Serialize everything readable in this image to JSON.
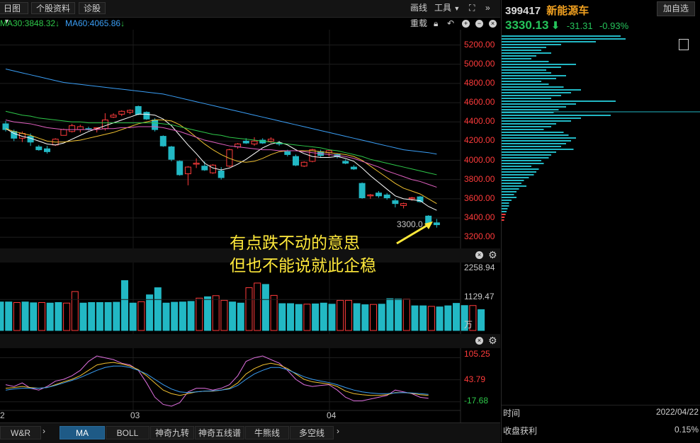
{
  "toolbar": {
    "period_label": "日图",
    "profile_label": "个股资料",
    "diagnose_label": "诊股",
    "draw_label": "画线",
    "tools_label": "工具",
    "reload_label": "重载"
  },
  "ma_legend": {
    "ma30": "MA30:3848.32",
    "ma60": "MA60:4065.86",
    "ma30_color": "#2ec84a",
    "ma60_color": "#3a9ef5"
  },
  "price_axis": {
    "labels": [
      "5200.00",
      "5000.00",
      "4800.00",
      "4600.00",
      "4400.00",
      "4200.00",
      "4000.00",
      "3800.00",
      "3600.00",
      "3400.00",
      "3200.00"
    ],
    "low_marker": "3300.0"
  },
  "volume_axis": {
    "labels": [
      "2258.94",
      "1129.47",
      "万"
    ]
  },
  "macd_axis": {
    "labels": [
      "105.25",
      "43.79",
      "-17.68"
    ]
  },
  "date_axis": {
    "labels": [
      "2",
      "03",
      "04"
    ]
  },
  "annotation": {
    "line1": "有点跌不动的意思",
    "line2": "但也不能说就此企稳",
    "color": "#ffe93b"
  },
  "tabs": {
    "wr": "W&R",
    "items": [
      "MA",
      "BOLL",
      "神奇九转",
      "神奇五线谱",
      "牛熊线",
      "多空线"
    ],
    "active": "MA"
  },
  "right_panel": {
    "code": "399417",
    "name": "新能源车",
    "add_button": "加自选",
    "price": "3330.13",
    "change": "-31.31",
    "change_pct": "-0.93%",
    "down_color": "#25c45b",
    "time_label": "时间",
    "time_value": "2022/04/22",
    "profit_label": "收盘获利",
    "profit_value": "0.15%"
  },
  "chart_data": {
    "type": "candlestick",
    "price_ylim": [
      3150,
      5300
    ],
    "candles": [
      [
        4380,
        4410,
        4300,
        4320
      ],
      [
        4300,
        4320,
        4200,
        4230
      ],
      [
        4230,
        4300,
        4190,
        4280
      ],
      [
        4250,
        4280,
        4150,
        4190
      ],
      [
        4140,
        4160,
        4100,
        4110
      ],
      [
        4120,
        4150,
        4070,
        4090
      ],
      [
        4160,
        4230,
        4150,
        4220
      ],
      [
        4260,
        4330,
        4260,
        4320
      ],
      [
        4300,
        4380,
        4290,
        4360
      ],
      [
        4320,
        4370,
        4290,
        4350
      ],
      [
        4330,
        4350,
        4310,
        4320
      ],
      [
        4330,
        4340,
        4290,
        4340
      ],
      [
        4330,
        4490,
        4310,
        4420
      ],
      [
        4450,
        4490,
        4440,
        4470
      ],
      [
        4480,
        4520,
        4460,
        4510
      ],
      [
        4500,
        4530,
        4480,
        4520
      ],
      [
        4560,
        4570,
        4470,
        4480
      ],
      [
        4500,
        4510,
        4420,
        4430
      ],
      [
        4420,
        4440,
        4300,
        4320
      ],
      [
        4250,
        4260,
        4140,
        4150
      ],
      [
        4140,
        4150,
        3990,
        4010
      ],
      [
        3990,
        4000,
        3840,
        3850
      ],
      [
        3860,
        3940,
        3740,
        3930
      ],
      [
        3960,
        4020,
        3920,
        3970
      ],
      [
        3940,
        3990,
        3890,
        3900
      ],
      [
        3870,
        3960,
        3860,
        3950
      ],
      [
        3890,
        3930,
        3800,
        3820
      ],
      [
        3940,
        4120,
        3930,
        4110
      ],
      [
        4140,
        4180,
        4120,
        4170
      ],
      [
        4200,
        4230,
        4170,
        4180
      ],
      [
        4170,
        4240,
        4150,
        4200
      ],
      [
        4210,
        4230,
        4170,
        4180
      ],
      [
        4200,
        4240,
        4180,
        4220
      ],
      [
        4180,
        4200,
        4150,
        4170
      ],
      [
        4090,
        4110,
        4040,
        4060
      ],
      [
        4040,
        4060,
        3940,
        3950
      ],
      [
        3940,
        3990,
        3930,
        3980
      ],
      [
        3990,
        4120,
        3980,
        4110
      ],
      [
        4090,
        4110,
        4030,
        4050
      ],
      [
        4080,
        4110,
        4040,
        4100
      ],
      [
        4060,
        4070,
        4020,
        4040
      ],
      [
        3990,
        4010,
        3960,
        3970
      ],
      [
        3930,
        3950,
        3900,
        3910
      ],
      [
        3760,
        3770,
        3600,
        3610
      ],
      [
        3630,
        3650,
        3600,
        3640
      ],
      [
        3660,
        3680,
        3610,
        3630
      ],
      [
        3640,
        3660,
        3590,
        3610
      ],
      [
        3580,
        3600,
        3510,
        3550
      ],
      [
        3530,
        3560,
        3500,
        3550
      ],
      [
        3600,
        3620,
        3580,
        3610
      ],
      [
        3620,
        3630,
        3560,
        3570
      ],
      [
        3420,
        3430,
        3330,
        3340
      ],
      [
        3350,
        3390,
        3300,
        3330
      ]
    ],
    "ma_lines": [
      {
        "name": "MA5",
        "color": "#ffffff",
        "values": [
          4330,
          4280,
          4250,
          4230,
          4200,
          4170,
          4160,
          4180,
          4220,
          4260,
          4300,
          4330,
          4360,
          4390,
          4420,
          4450,
          4480,
          4480,
          4470,
          4430,
          4360,
          4260,
          4160,
          4070,
          3970,
          3920,
          3900,
          3920,
          3960,
          4010,
          4070,
          4130,
          4170,
          4190,
          4160,
          4110,
          4070,
          4040,
          4030,
          4030,
          4040,
          4020,
          3990,
          3920,
          3840,
          3770,
          3700,
          3630,
          3600,
          3590,
          3580,
          3520,
          3480
        ]
      },
      {
        "name": "MA10",
        "color": "#f0c030",
        "values": [
          4330,
          4300,
          4280,
          4260,
          4230,
          4200,
          4190,
          4190,
          4200,
          4210,
          4230,
          4250,
          4270,
          4290,
          4320,
          4350,
          4380,
          4400,
          4420,
          4420,
          4410,
          4370,
          4310,
          4240,
          4170,
          4110,
          4060,
          4020,
          3990,
          3980,
          3990,
          4020,
          4060,
          4090,
          4100,
          4100,
          4100,
          4100,
          4090,
          4080,
          4070,
          4060,
          4040,
          4000,
          3940,
          3880,
          3820,
          3760,
          3710,
          3680,
          3650,
          3600,
          3550
        ]
      },
      {
        "name": "MA20",
        "color": "#e060c0",
        "values": [
          4420,
          4400,
          4390,
          4380,
          4360,
          4340,
          4330,
          4320,
          4320,
          4320,
          4320,
          4320,
          4330,
          4330,
          4340,
          4340,
          4350,
          4350,
          4350,
          4340,
          4320,
          4300,
          4270,
          4240,
          4210,
          4190,
          4170,
          4150,
          4140,
          4130,
          4120,
          4110,
          4110,
          4100,
          4100,
          4100,
          4090,
          4080,
          4070,
          4060,
          4050,
          4040,
          4020,
          3990,
          3960,
          3930,
          3890,
          3860,
          3830,
          3800,
          3780,
          3750,
          3720
        ]
      },
      {
        "name": "MA30",
        "color": "#2ec84a",
        "values": [
          4510,
          4490,
          4470,
          4460,
          4440,
          4430,
          4420,
          4410,
          4400,
          4400,
          4390,
          4390,
          4390,
          4390,
          4390,
          4390,
          4390,
          4390,
          4390,
          4380,
          4370,
          4350,
          4330,
          4310,
          4290,
          4270,
          4260,
          4240,
          4230,
          4220,
          4210,
          4200,
          4190,
          4180,
          4170,
          4160,
          4150,
          4140,
          4130,
          4110,
          4100,
          4080,
          4060,
          4040,
          4010,
          3990,
          3970,
          3950,
          3930,
          3910,
          3890,
          3870,
          3850
        ]
      },
      {
        "name": "MA60",
        "color": "#3a9ef5",
        "values": [
          4950,
          4930,
          4910,
          4890,
          4870,
          4850,
          4830,
          4810,
          4800,
          4790,
          4780,
          4770,
          4760,
          4750,
          4740,
          4730,
          4720,
          4710,
          4700,
          4690,
          4670,
          4650,
          4630,
          4610,
          4590,
          4570,
          4550,
          4530,
          4510,
          4490,
          4470,
          4450,
          4430,
          4410,
          4390,
          4370,
          4350,
          4330,
          4310,
          4290,
          4270,
          4250,
          4230,
          4210,
          4190,
          4170,
          4150,
          4130,
          4110,
          4100,
          4090,
          4080,
          4065
        ]
      }
    ],
    "volume_ylim": [
      0,
      2400
    ],
    "volumes": [
      1040,
      1040,
      1020,
      1040,
      1010,
      1020,
      1000,
      1020,
      1000,
      1420,
      1000,
      1020,
      1020,
      1020,
      1030,
      1820,
      1000,
      1050,
      1300,
      1560,
      1000,
      1030,
      1040,
      1060,
      1180,
      1230,
      1270,
      1100,
      1040,
      1000,
      1560,
      1730,
      1680,
      1280,
      980,
      980,
      950,
      960,
      970,
      1000,
      960,
      1100,
      1100,
      980,
      940,
      950,
      960,
      1160,
      1150,
      1140,
      900,
      900,
      880,
      860,
      900,
      990,
      910,
      910,
      760
    ],
    "volume_up": [
      false,
      false,
      true,
      false,
      false,
      true,
      false,
      false,
      true,
      true,
      false,
      false,
      false,
      false,
      false,
      false,
      false,
      true,
      false,
      false,
      false,
      false,
      false,
      false,
      true,
      false,
      true,
      true,
      false,
      false,
      true,
      true,
      false,
      true,
      false,
      false,
      false,
      true,
      false,
      false,
      false,
      true,
      true,
      false,
      false,
      true,
      false,
      false,
      false,
      true,
      false,
      false,
      true,
      false,
      false,
      false,
      false,
      true,
      false
    ],
    "macd_ylim": [
      -30,
      120
    ],
    "macd_lines": [
      {
        "name": "K",
        "color": "#e070e0",
        "values": [
          30,
          25,
          35,
          20,
          15,
          25,
          40,
          45,
          55,
          70,
          95,
          110,
          105,
          100,
          90,
          85,
          70,
          35,
          -5,
          -25,
          -30,
          -20,
          10,
          20,
          20,
          15,
          20,
          30,
          55,
          95,
          105,
          110,
          100,
          90,
          70,
          45,
          30,
          25,
          28,
          30,
          15,
          -5,
          -15,
          -15,
          -10,
          -5,
          0,
          15,
          10,
          5,
          -5,
          -8
        ]
      },
      {
        "name": "D",
        "color": "#f0c030",
        "values": [
          20,
          22,
          25,
          22,
          20,
          22,
          30,
          38,
          45,
          55,
          70,
          85,
          90,
          92,
          88,
          82,
          72,
          55,
          35,
          15,
          5,
          0,
          5,
          10,
          12,
          12,
          15,
          20,
          35,
          60,
          75,
          85,
          90,
          85,
          75,
          60,
          45,
          38,
          35,
          32,
          25,
          12,
          5,
          2,
          0,
          0,
          2,
          8,
          8,
          6,
          2,
          0
        ]
      },
      {
        "name": "J",
        "color": "#3a9ef5",
        "values": [
          15,
          18,
          20,
          20,
          20,
          22,
          28,
          35,
          42,
          50,
          60,
          70,
          78,
          82,
          82,
          78,
          70,
          60,
          45,
          30,
          18,
          10,
          8,
          10,
          12,
          13,
          15,
          18,
          28,
          45,
          60,
          70,
          78,
          78,
          72,
          62,
          52,
          45,
          40,
          36,
          30,
          22,
          15,
          10,
          7,
          5,
          5,
          7,
          8,
          7,
          5,
          3
        ]
      }
    ],
    "right_profile": "volume-at-price bars (cyan), peaks near 4700 and 4450"
  }
}
